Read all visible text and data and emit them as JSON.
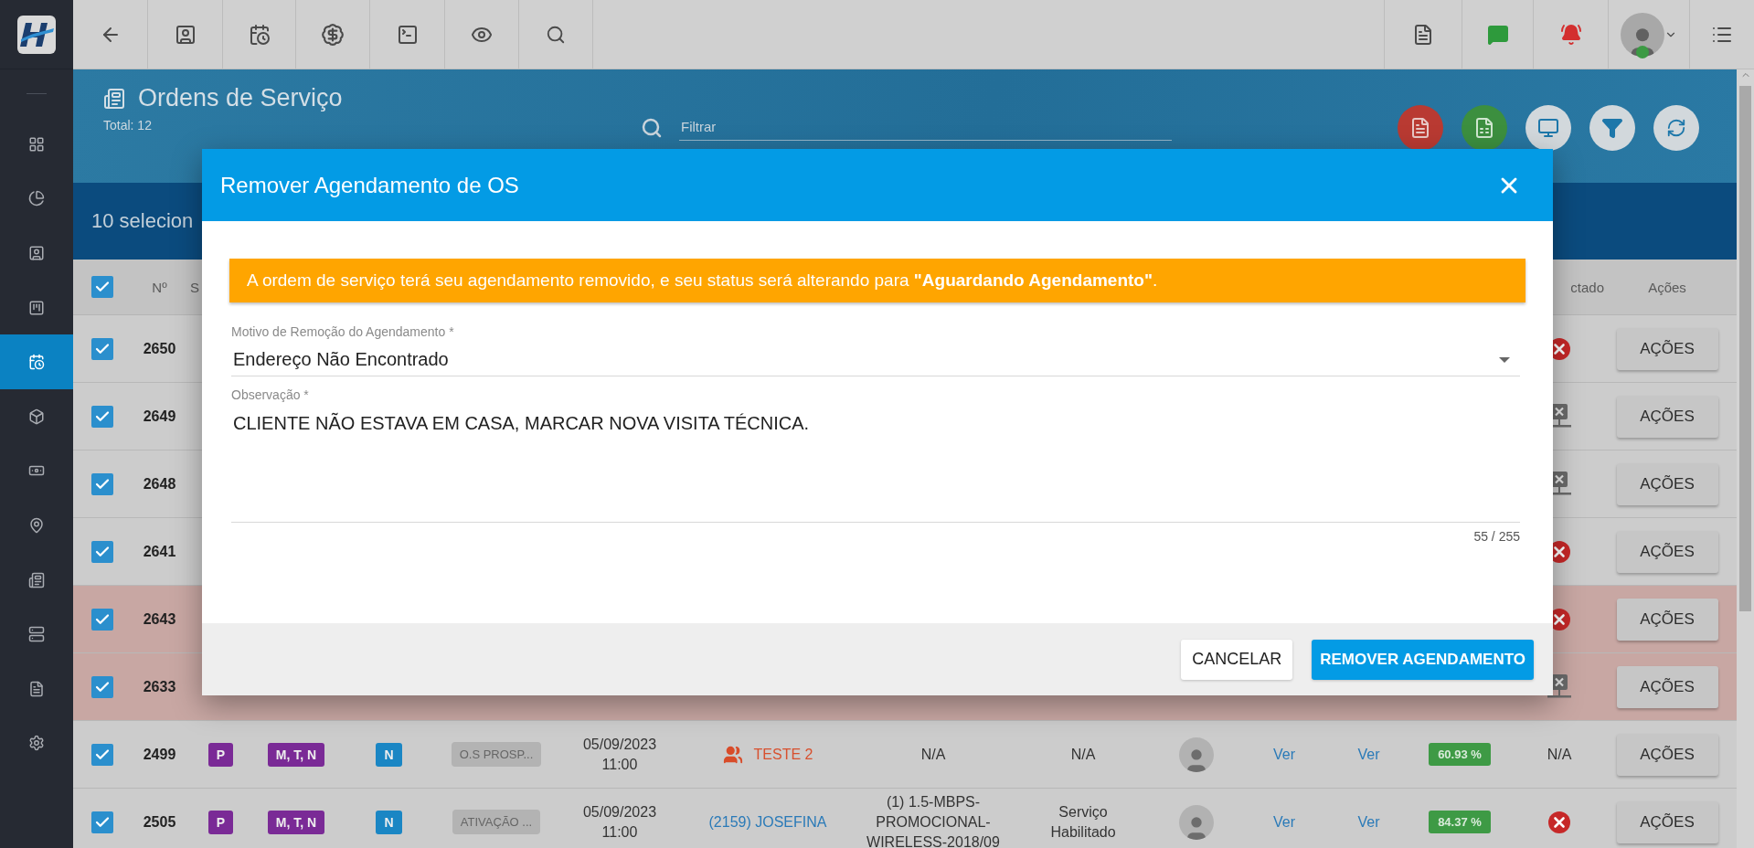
{
  "sidebar": {
    "items": [
      {
        "selected": false
      },
      {
        "selected": false
      },
      {
        "selected": false
      },
      {
        "selected": false
      },
      {
        "selected": true
      },
      {
        "selected": false
      },
      {
        "selected": false
      },
      {
        "selected": false
      },
      {
        "selected": false
      },
      {
        "selected": false
      },
      {
        "selected": false
      },
      {
        "selected": false
      }
    ]
  },
  "user": {
    "online": true
  },
  "header": {
    "title": "Ordens de Serviço",
    "total": "Total: 12",
    "filter": {
      "placeholder": "Filtrar"
    }
  },
  "selection_bar": {
    "text": "10 selecion"
  },
  "table": {
    "select_all": {
      "checked": true
    },
    "columns": {
      "number": "Nº",
      "column_3": "S",
      "column_15": "ctado",
      "actions": "Ações"
    },
    "rows": [
      {
        "kind": "covered",
        "number": "2650",
        "checked": true,
        "highlighted": false,
        "link": {
          "kind": "error"
        },
        "action": "AÇÕES"
      },
      {
        "kind": "covered",
        "number": "2649",
        "checked": true,
        "highlighted": false,
        "link": {
          "kind": "offline"
        },
        "action": "AÇÕES"
      },
      {
        "kind": "covered",
        "number": "2648",
        "checked": true,
        "highlighted": false,
        "link": {
          "kind": "offline"
        },
        "action": "AÇÕES"
      },
      {
        "kind": "covered",
        "number": "2641",
        "checked": true,
        "highlighted": false,
        "link": {
          "kind": "error"
        },
        "action": "AÇÕES"
      },
      {
        "kind": "covered",
        "number": "2643",
        "checked": true,
        "highlighted": true,
        "link": {
          "kind": "error"
        },
        "action": "AÇÕES"
      },
      {
        "kind": "covered",
        "number": "2633",
        "checked": true,
        "highlighted": true,
        "link": {
          "kind": "offline"
        },
        "action": "AÇÕES"
      },
      {
        "kind": "full",
        "number": "2499",
        "checked": true,
        "highlighted": false,
        "type": "P",
        "shifts": "M, T, N",
        "period": "N",
        "category": "O.S PROSP...",
        "date": "05/09/2023",
        "time": "11:00",
        "client": {
          "kind": "lead",
          "text": "TESTE 2"
        },
        "plan": "N/A",
        "status": "N/A",
        "column_12": "Ver",
        "column_13": "Ver",
        "progress": "60.93 %",
        "link": {
          "kind": "text",
          "text": "N/A"
        },
        "action": "AÇÕES"
      },
      {
        "kind": "full",
        "number": "2505",
        "checked": true,
        "highlighted": false,
        "type": "P",
        "shifts": "M, T, N",
        "period": "N",
        "category": "ATIVAÇÃO ...",
        "date": "05/09/2023",
        "time": "11:00",
        "client": {
          "kind": "customer",
          "text": "(2159) JOSEFINA"
        },
        "plan": "(1) 1.5-MBPS-PROMOCIONAL-WIRELESS-2018/09",
        "status": "Serviço Habilitado",
        "column_12": "Ver",
        "column_13": "Ver",
        "progress": "84.37 %",
        "link": {
          "kind": "error"
        },
        "action": "AÇÕES"
      }
    ]
  },
  "modal": {
    "title": "Remover Agendamento de OS",
    "alert": "A ordem de serviço terá seu agendamento removido, e seu status será alterando para **\"Aguardando Agendamento\"**.",
    "reason": {
      "label": "Motivo de Remoção do Agendamento *",
      "value": "Endereço Não Encontrado"
    },
    "observation": {
      "label": "Observação *",
      "value": "CLIENTE NÃO ESTAVA EM CASA, MARCAR NOVA VISITA TÉCNICA.",
      "counter": "55 / 255"
    },
    "buttons": {
      "cancel": "CANCELAR",
      "confirm": "REMOVER AGENDAMENTO"
    }
  }
}
